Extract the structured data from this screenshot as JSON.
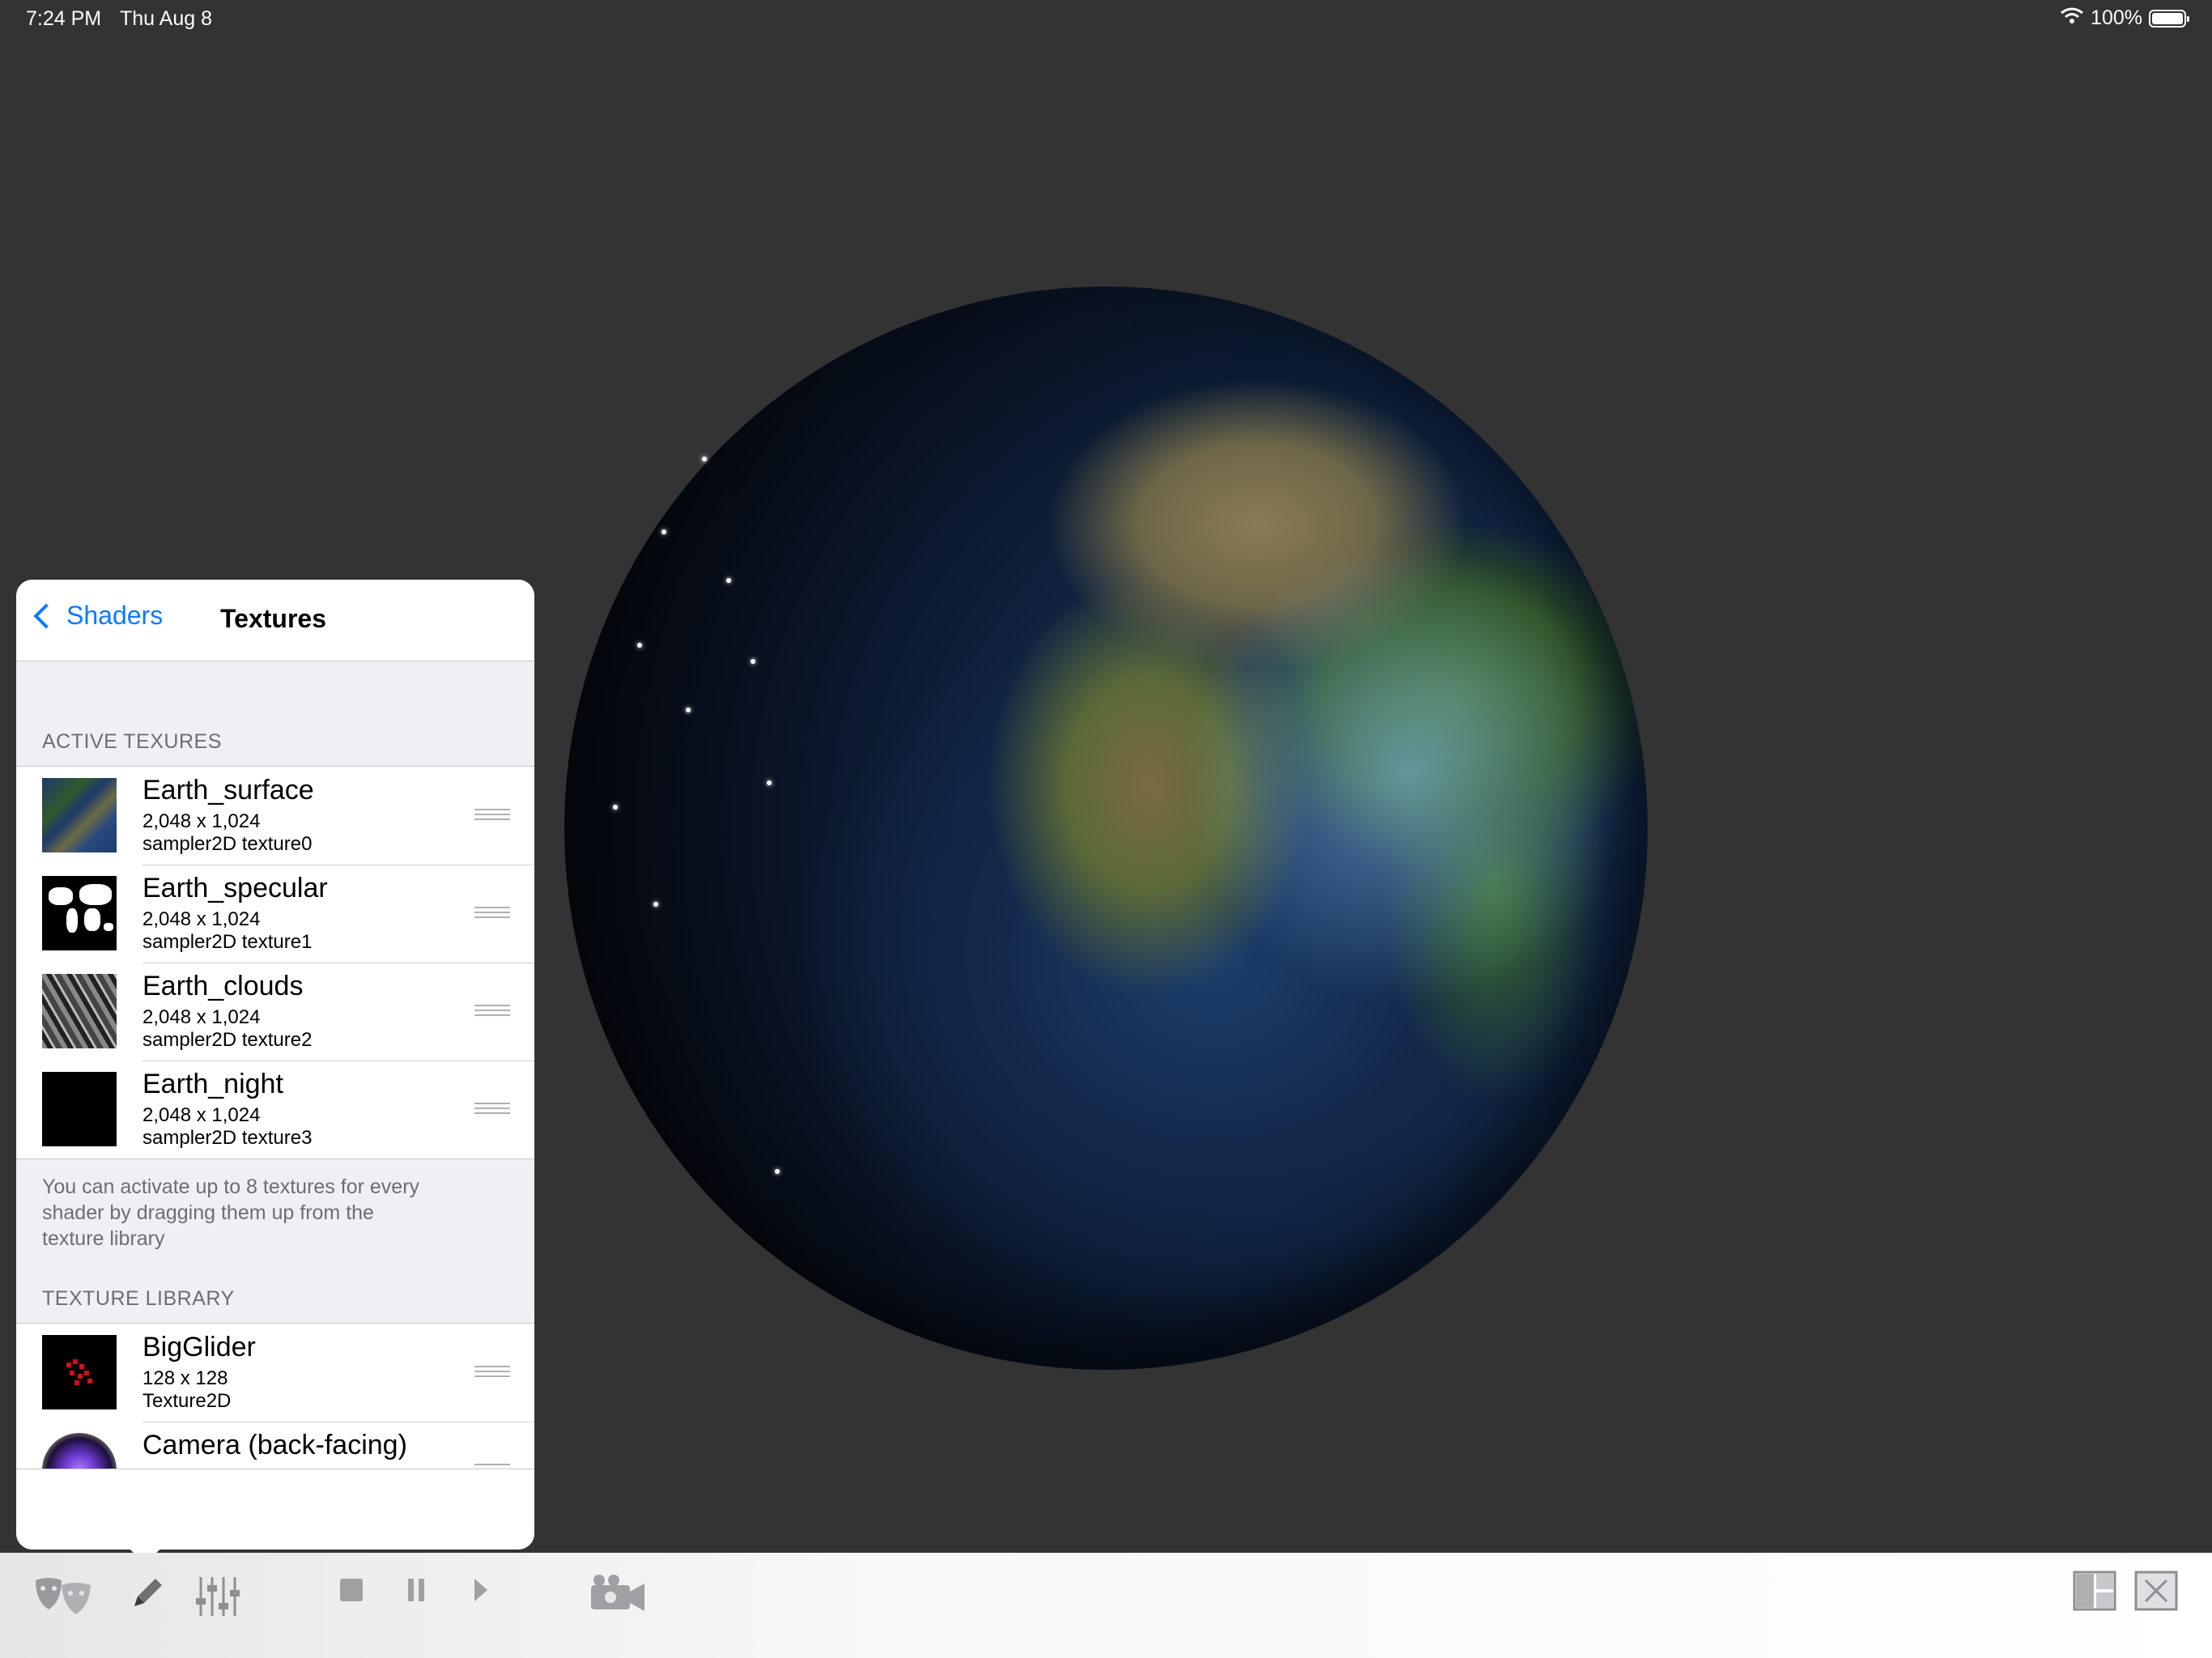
{
  "status_bar": {
    "time": "7:24 PM",
    "date": "Thu Aug 8",
    "battery": "100%",
    "icons": [
      "wifi-icon",
      "battery-icon"
    ]
  },
  "scene": {
    "object": "earth-globe",
    "colors": {
      "background": "#333333",
      "ocean": "#1b3a66",
      "land": "#6e6848"
    }
  },
  "panel": {
    "back_label": "Shaders",
    "title": "Textures",
    "active_section": "ACTIVE TEXURES",
    "active_textures": [
      {
        "name": "Earth_surface",
        "dims": "2,048 x 1,024",
        "type": "sampler2D texture0"
      },
      {
        "name": "Earth_specular",
        "dims": "2,048 x 1,024",
        "type": "sampler2D texture1"
      },
      {
        "name": "Earth_clouds",
        "dims": "2,048 x 1,024",
        "type": "sampler2D texture2"
      },
      {
        "name": "Earth_night",
        "dims": "2,048 x 1,024",
        "type": "sampler2D texture3"
      }
    ],
    "note": "You can activate up to 8 textures for every shader by dragging them up from the texture library",
    "library_section": "TEXTURE LIBRARY",
    "library": [
      {
        "name": "BigGlider",
        "dims": "128 x 128",
        "type": "Texture2D"
      },
      {
        "name": "Camera (back-facing)",
        "dims": "",
        "type": ""
      }
    ],
    "accent_color": "#0a7aff"
  },
  "toolbar": {
    "icons": [
      "theater-masks-icon",
      "pencil-icon",
      "sliders-icon",
      "stop-icon",
      "pause-icon",
      "play-icon",
      "video-camera-icon",
      "layout-icon",
      "close-window-icon"
    ]
  }
}
